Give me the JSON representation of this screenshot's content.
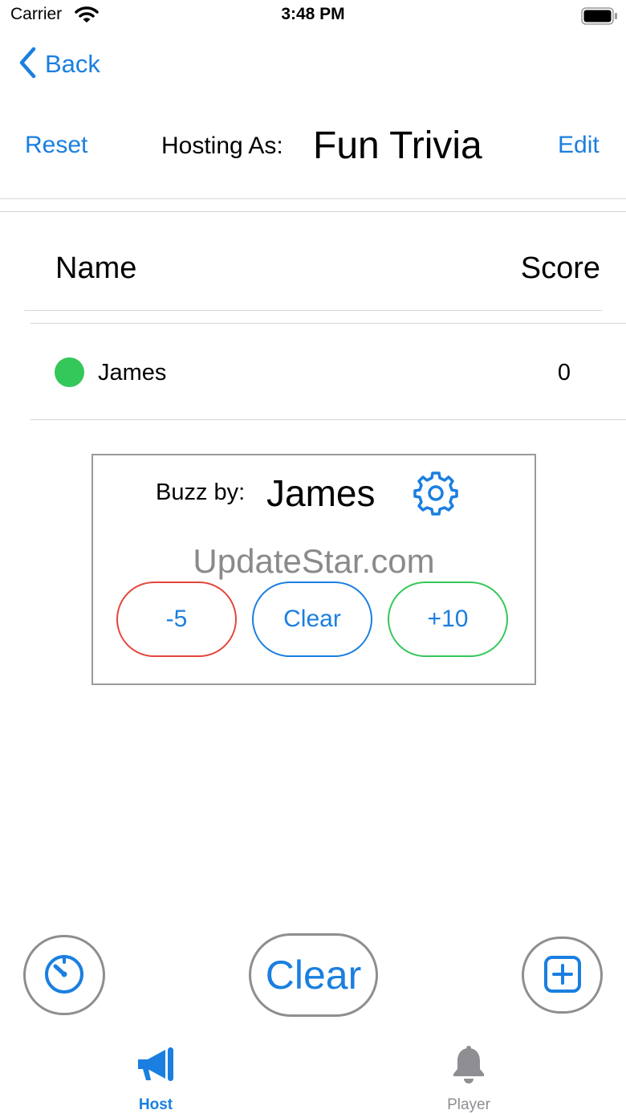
{
  "status_bar": {
    "carrier": "Carrier",
    "time": "3:48 PM",
    "wifi_icon": "wifi-icon",
    "battery_icon": "battery-icon"
  },
  "nav": {
    "back_label": "Back",
    "back_icon": "chevron-left-icon"
  },
  "header": {
    "reset_label": "Reset",
    "hosting_label": "Hosting As:",
    "game_title": "Fun Trivia",
    "edit_label": "Edit"
  },
  "table": {
    "columns": {
      "name": "Name",
      "score": "Score"
    },
    "rows": [
      {
        "name": "James",
        "score": "0",
        "status_color": "#34c759"
      }
    ]
  },
  "buzz_panel": {
    "label": "Buzz by:",
    "player": "James",
    "settings_icon": "gear-icon",
    "watermark": "UpdateStar.com",
    "buttons": {
      "minus": "-5",
      "clear": "Clear",
      "plus": "+10"
    }
  },
  "controls": {
    "timer_icon": "timer-icon",
    "clear_label": "Clear",
    "add_icon": "plus-square-icon"
  },
  "tab_bar": {
    "tabs": [
      {
        "label": "Host",
        "icon": "megaphone-icon",
        "active": true
      },
      {
        "label": "Player",
        "icon": "bell-icon",
        "active": false
      }
    ]
  },
  "colors": {
    "accent": "#1a7fe0",
    "red": "#e5453b",
    "green": "#34c759",
    "gray": "#8e8e93"
  }
}
